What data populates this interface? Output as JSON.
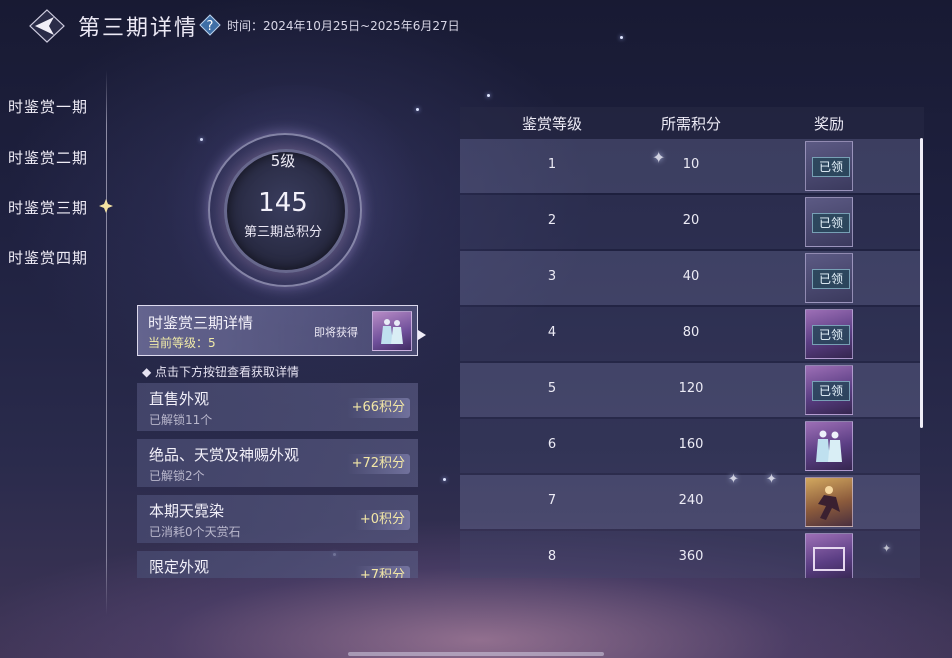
{
  "header": {
    "title": "第三期详情",
    "period_label": "时间：",
    "period_range": "2024年10月25日~2025年6月27日"
  },
  "tabs": [
    {
      "label": "时鉴赏一期",
      "selected": false
    },
    {
      "label": "时鉴赏二期",
      "selected": false
    },
    {
      "label": "时鉴赏三期",
      "selected": true
    },
    {
      "label": "时鉴赏四期",
      "selected": false
    }
  ],
  "summary": {
    "level": "5级",
    "total_points": "145",
    "total_points_label": "第三期总积分"
  },
  "detail_card": {
    "title": "时鉴赏三期详情",
    "current_level": "当前等级：5",
    "upcoming_label": "即将获得"
  },
  "hint": "◆ 点击下方按钮查看获取详情",
  "sources": [
    {
      "title": "直售外观",
      "subtitle": "已解锁11个",
      "points": "+66积分"
    },
    {
      "title": "绝品、天赏及神赐外观",
      "subtitle": "已解锁2个",
      "points": "+72积分"
    },
    {
      "title": "本期天霓染",
      "subtitle": "已消耗0个天赏石",
      "points": "+0积分"
    },
    {
      "title": "限定外观",
      "subtitle": "",
      "points": "+7积分"
    }
  ],
  "table": {
    "headers": [
      "鉴赏等级",
      "所需积分",
      "奖励"
    ],
    "rows": [
      {
        "level": "1",
        "points": "10",
        "reward_style": "plain",
        "claimed": "已领"
      },
      {
        "level": "2",
        "points": "20",
        "reward_style": "plain",
        "claimed": "已领"
      },
      {
        "level": "3",
        "points": "40",
        "reward_style": "plain",
        "claimed": "已领"
      },
      {
        "level": "4",
        "points": "80",
        "reward_style": "purple",
        "claimed": "已领"
      },
      {
        "level": "5",
        "points": "120",
        "reward_style": "purple",
        "claimed": "已领"
      },
      {
        "level": "6",
        "points": "160",
        "reward_style": "purple",
        "claimed": ""
      },
      {
        "level": "7",
        "points": "240",
        "reward_style": "gold",
        "claimed": ""
      },
      {
        "level": "8",
        "points": "360",
        "reward_style": "purple",
        "claimed": ""
      }
    ]
  },
  "colors": {
    "accent_gold": "#f3e7a6",
    "claimed_badge": "#284659",
    "panel": "#46486e"
  }
}
